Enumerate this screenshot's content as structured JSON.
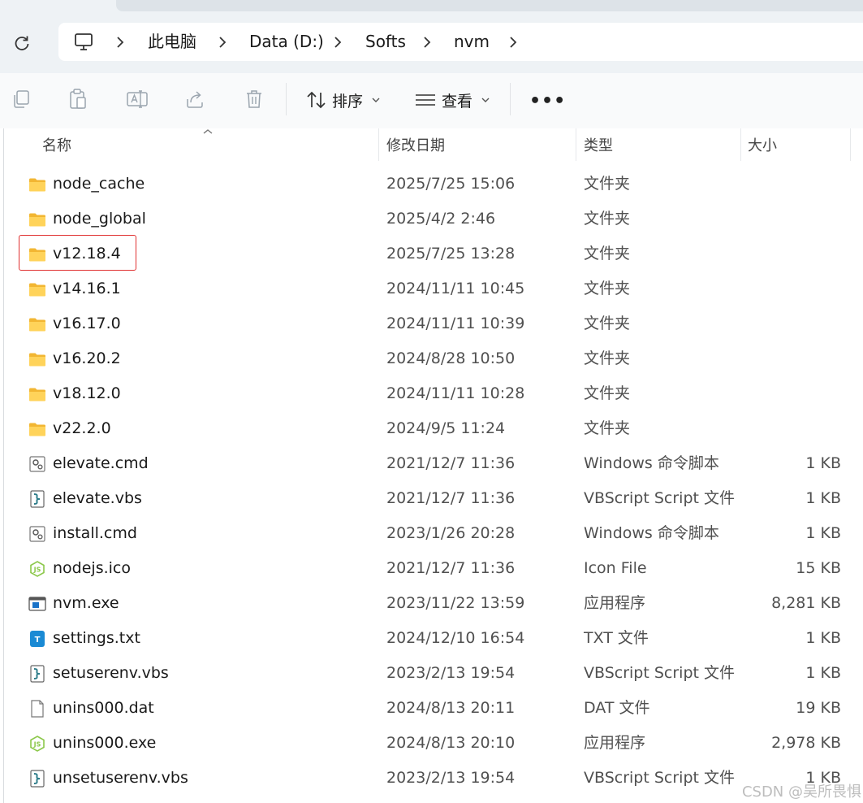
{
  "breadcrumb": {
    "items": [
      "此电脑",
      "Data (D:)",
      "Softs",
      "nvm"
    ]
  },
  "toolbar": {
    "sort_label": "排序",
    "view_label": "查看",
    "more_label": "•••"
  },
  "columns": {
    "name": "名称",
    "date": "修改日期",
    "type": "类型",
    "size": "大小"
  },
  "files": [
    {
      "name": "node_cache",
      "date": "2025/7/25 15:06",
      "type": "文件夹",
      "size": "",
      "icon": "folder-icon"
    },
    {
      "name": "node_global",
      "date": "2025/4/2 2:46",
      "type": "文件夹",
      "size": "",
      "icon": "folder-icon"
    },
    {
      "name": "v12.18.4",
      "date": "2025/7/25 13:28",
      "type": "文件夹",
      "size": "",
      "icon": "folder-icon"
    },
    {
      "name": "v14.16.1",
      "date": "2024/11/11 10:45",
      "type": "文件夹",
      "size": "",
      "icon": "folder-icon"
    },
    {
      "name": "v16.17.0",
      "date": "2024/11/11 10:39",
      "type": "文件夹",
      "size": "",
      "icon": "folder-icon"
    },
    {
      "name": "v16.20.2",
      "date": "2024/8/28 10:50",
      "type": "文件夹",
      "size": "",
      "icon": "folder-icon"
    },
    {
      "name": "v18.12.0",
      "date": "2024/11/11 10:28",
      "type": "文件夹",
      "size": "",
      "icon": "folder-icon"
    },
    {
      "name": "v22.2.0",
      "date": "2024/9/5 11:24",
      "type": "文件夹",
      "size": "",
      "icon": "folder-icon"
    },
    {
      "name": "elevate.cmd",
      "date": "2021/12/7 11:36",
      "type": "Windows 命令脚本",
      "size": "1 KB",
      "icon": "cmd-script-icon"
    },
    {
      "name": "elevate.vbs",
      "date": "2021/12/7 11:36",
      "type": "VBScript Script 文件",
      "size": "1 KB",
      "icon": "vbs-script-icon"
    },
    {
      "name": "install.cmd",
      "date": "2023/1/26 20:28",
      "type": "Windows 命令脚本",
      "size": "1 KB",
      "icon": "cmd-script-icon"
    },
    {
      "name": "nodejs.ico",
      "date": "2021/12/7 11:36",
      "type": "Icon File",
      "size": "15 KB",
      "icon": "nodejs-icon"
    },
    {
      "name": "nvm.exe",
      "date": "2023/11/22 13:59",
      "type": "应用程序",
      "size": "8,281 KB",
      "icon": "exe-window-icon"
    },
    {
      "name": "settings.txt",
      "date": "2024/12/10 16:54",
      "type": "TXT 文件",
      "size": "1 KB",
      "icon": "txt-file-icon"
    },
    {
      "name": "setuserenv.vbs",
      "date": "2023/2/13 19:54",
      "type": "VBScript Script 文件",
      "size": "1 KB",
      "icon": "vbs-script-icon"
    },
    {
      "name": "unins000.dat",
      "date": "2024/8/13 20:11",
      "type": "DAT 文件",
      "size": "19 KB",
      "icon": "blank-file-icon"
    },
    {
      "name": "unins000.exe",
      "date": "2024/8/13 20:10",
      "type": "应用程序",
      "size": "2,978 KB",
      "icon": "nodejs-icon"
    },
    {
      "name": "unsetuserenv.vbs",
      "date": "2023/2/13 19:54",
      "type": "VBScript Script 文件",
      "size": "1 KB",
      "icon": "vbs-script-icon"
    }
  ],
  "watermark": "CSDN @吴所畏惧",
  "colors": {
    "folder": "#f7c948",
    "highlight_border": "#e03030",
    "accent_blue": "#1a73c8"
  }
}
